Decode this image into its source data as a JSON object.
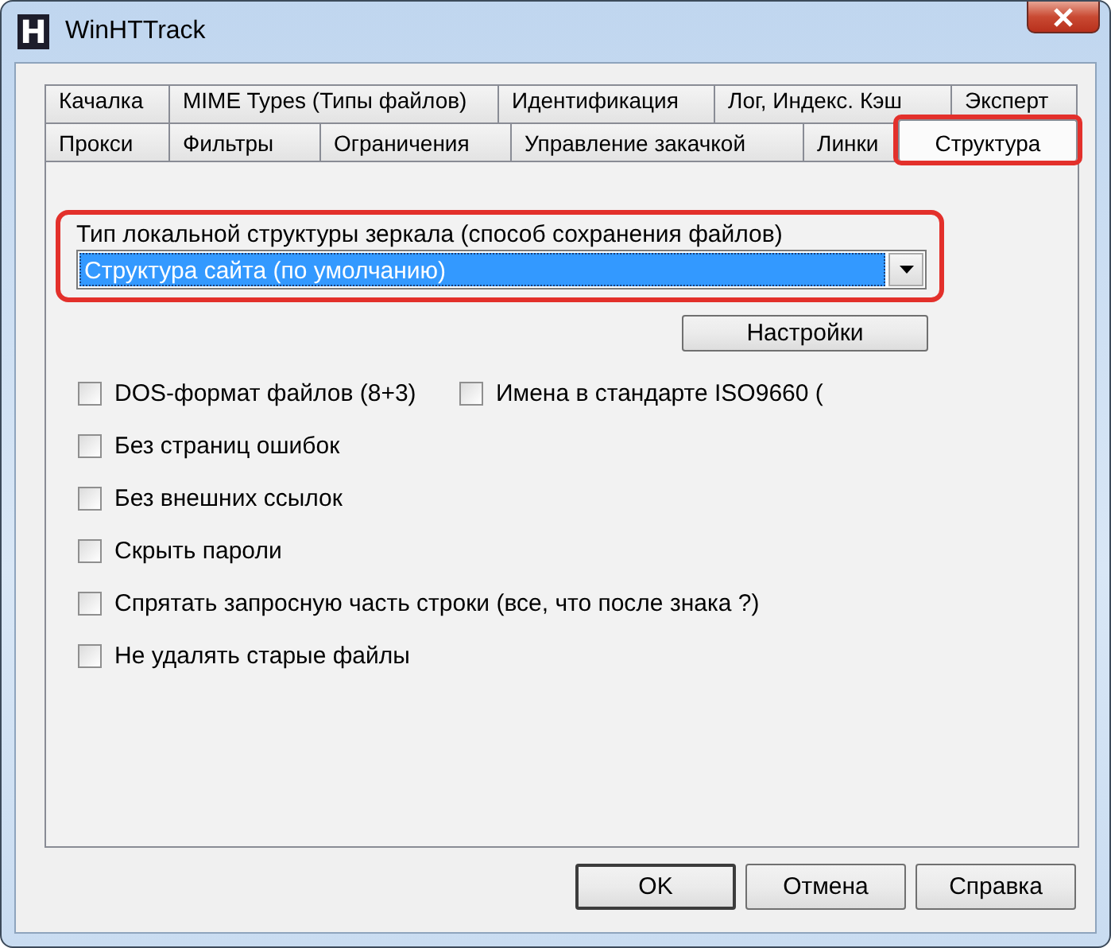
{
  "window": {
    "icon_letter": "H",
    "title": "WinHTTrack"
  },
  "tab_rows": [
    [
      {
        "label": "Качалка",
        "selected": false,
        "highlighted": false
      },
      {
        "label": "MIME Types (Типы файлов)",
        "selected": false,
        "highlighted": false
      },
      {
        "label": "Идентификация",
        "selected": false,
        "highlighted": false
      },
      {
        "label": "Лог, Индекс. Кэш",
        "selected": false,
        "highlighted": false
      },
      {
        "label": "Эксперт",
        "selected": false,
        "highlighted": false
      }
    ],
    [
      {
        "label": "Прокси",
        "selected": false,
        "highlighted": false
      },
      {
        "label": "Фильтры",
        "selected": false,
        "highlighted": false
      },
      {
        "label": "Ограничения",
        "selected": false,
        "highlighted": false
      },
      {
        "label": "Управление закачкой",
        "selected": false,
        "highlighted": false
      },
      {
        "label": "Линки",
        "selected": false,
        "highlighted": false
      },
      {
        "label": "Структура",
        "selected": true,
        "highlighted": true
      }
    ]
  ],
  "structure": {
    "label": "Тип локальной структуры зеркала (способ сохранения файлов)",
    "value": "Структура сайта (по умолчанию)",
    "highlighted": true
  },
  "settings_button": "Настройки",
  "option_rows": [
    [
      {
        "label": "DOS-формат файлов (8+3)",
        "checked": false
      },
      {
        "label": "Имена в стандарте ISO9660 (",
        "checked": false
      }
    ],
    [
      {
        "label": "Без страниц ошибок",
        "checked": false
      }
    ],
    [
      {
        "label": "Без внешних ссылок",
        "checked": false
      }
    ],
    [
      {
        "label": "Скрыть пароли",
        "checked": false
      }
    ],
    [
      {
        "label": "Спрятать запросную часть строки (все, что после знака ?)",
        "checked": false
      }
    ],
    [
      {
        "label": "Не удалять старые файлы",
        "checked": false
      }
    ]
  ],
  "buttons": [
    {
      "label": "OK",
      "default": true
    },
    {
      "label": "Отмена",
      "default": false
    },
    {
      "label": "Справка",
      "default": false
    }
  ]
}
